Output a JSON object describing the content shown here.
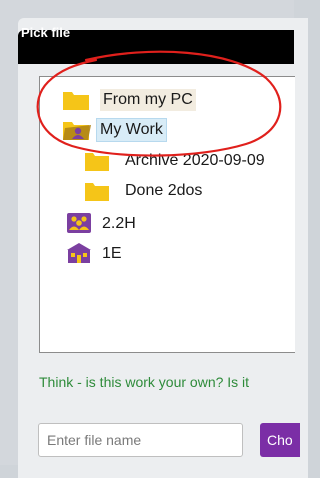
{
  "dialog": {
    "title": "Pick file"
  },
  "tree": [
    {
      "label": "From my PC",
      "icon": "folder-icon"
    },
    {
      "label": "My Work",
      "icon": "user-folder-icon"
    },
    {
      "label": "Archive 2020-09-09",
      "icon": "folder-icon"
    },
    {
      "label": "Done 2dos",
      "icon": "folder-icon"
    },
    {
      "label": "2.2H",
      "icon": "group-icon"
    },
    {
      "label": "1E",
      "icon": "school-icon"
    }
  ],
  "hint": "Think - is this work your own? Is it",
  "filename": {
    "placeholder": "Enter file name",
    "value": ""
  },
  "choose_button_label": "Cho",
  "colors": {
    "folder": "#f5c518",
    "group": "#7b3fa0",
    "hint": "#2e8b3a",
    "accent": "#7b2ea6",
    "annotation": "#e0201c"
  }
}
